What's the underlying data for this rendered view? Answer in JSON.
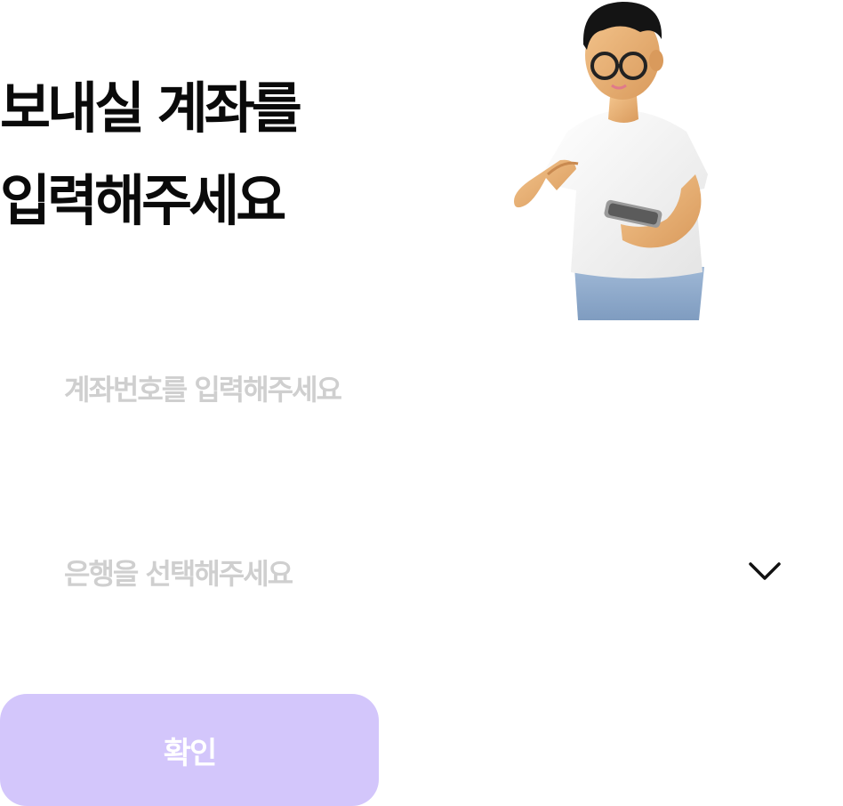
{
  "header": {
    "title_line1": "보내실 계좌를",
    "title_line2": "입력해주세요"
  },
  "account_number": {
    "value": "",
    "placeholder": "계좌번호를 입력해주세요"
  },
  "bank_select": {
    "selected_label": "은행을 선택해주세요",
    "icon": "chevron-down-icon"
  },
  "confirm_button": {
    "label": "확인"
  },
  "illustration": {
    "icon": "person-with-phone-illustration"
  },
  "colors": {
    "button_bg": "#d3c6fb",
    "button_text": "#ffffff",
    "placeholder": "#cfcfcf",
    "title": "#0a0a0a"
  }
}
